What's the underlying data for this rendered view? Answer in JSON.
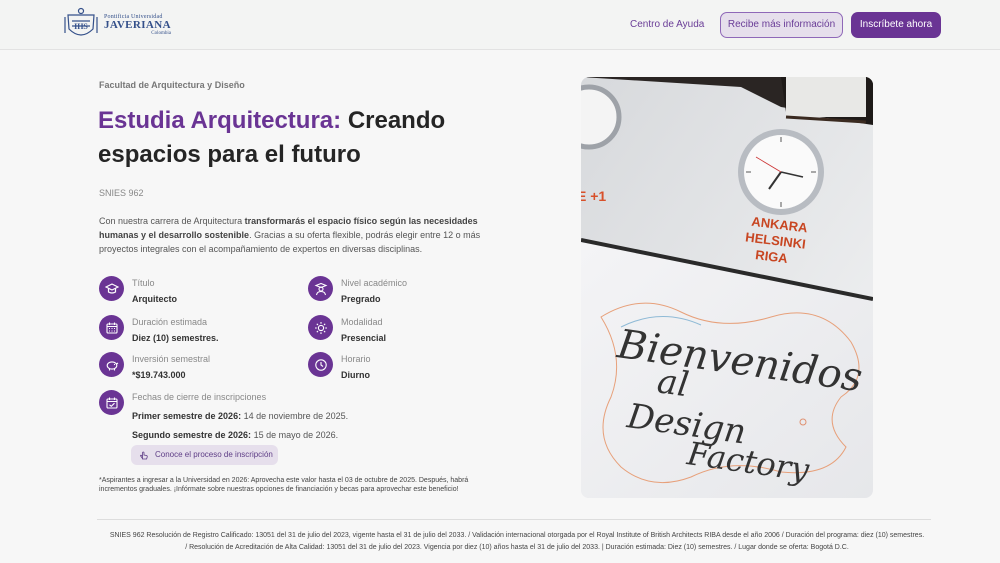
{
  "header": {
    "logo": {
      "line1": "Pontificia Universidad",
      "line2": "JAVERIANA",
      "line3": "Colombia"
    },
    "help_link": "Centro de Ayuda",
    "info_button": "Recibe más información",
    "enroll_button": "Inscríbete ahora"
  },
  "program": {
    "faculty": "Facultad de Arquitectura y Diseño",
    "title_accent": "Estudia Arquitectura:",
    "title_rest": "Creando espacios para el futuro",
    "snies": "SNIES 962",
    "description": {
      "p1": "Con nuestra carrera de Arquitectura ",
      "bold": "transformarás el espacio físico según las necesidades humanas y el desarrollo sostenible",
      "p2": ". Gracias a su oferta flexible, podrás elegir entre 12 o más proyectos integrales con el acompañamiento de expertos en diversas disciplinas."
    },
    "details": [
      {
        "label": "Título",
        "value": "Arquitecto",
        "icon": "graduation-cap-icon"
      },
      {
        "label": "Nivel académico",
        "value": "Pregrado",
        "icon": "graduate-person-icon"
      },
      {
        "label": "Duración estimada",
        "value": "Diez (10) semestres.",
        "icon": "calendar-grid-icon"
      },
      {
        "label": "Modalidad",
        "value": "Presencial",
        "icon": "sun-icon"
      },
      {
        "label": "Inversión semestral",
        "value": "*$19.743.000",
        "icon": "piggy-bank-icon"
      },
      {
        "label": "Horario",
        "value": "Diurno",
        "icon": "clock-icon"
      }
    ],
    "closing": {
      "label": "Fechas de cierre de inscripciones",
      "first_bold": "Primer semestre de 2026:",
      "first_date": " 14 de noviembre de 2025.",
      "second_bold": "Segundo semestre de 2026:",
      "second_date": " 15 de mayo de 2026.",
      "icon": "calendar-check-icon"
    },
    "process_button": "Conoce el proceso de inscripción",
    "footnote": "*Aspirantes a ingresar a la Universidad en 2026: Aprovecha este valor hasta el 03 de octubre de 2025. Después, habrá incrementos graduales. ¡Infórmate sobre nuestras opciones de financiación y becas para aprovechar este beneficio!"
  },
  "photo": {
    "wall_text": [
      "ANKARA",
      "HELSINKI",
      "RIGA"
    ],
    "wall_text_partial": "E +1",
    "board_lines": [
      "Bienvenidos",
      "al",
      "Design",
      "Factory"
    ]
  },
  "footer": {
    "line1": "SNIES 962 Resolución de Registro Calificado: 13051 del 31 de julio del 2023, vigente hasta el 31 de julio del 2033. / Validación internacional otorgada por el Royal Institute of British Architects RIBA desde el año 2006 / Duración del programa: diez (10) semestres.",
    "line2": "/ Resolución de Acreditación de Alta Calidad: 13051 del 31 de julio del 2023. Vigencia por diez (10) años hasta el 31 de julio del 2033. | Duración estimada: Diez (10) semestres. / Lugar donde se oferta: Bogotá D.C."
  },
  "colors": {
    "accent": "#6a3494",
    "accent_light": "#e6dfec",
    "logo_blue": "#34508a"
  }
}
